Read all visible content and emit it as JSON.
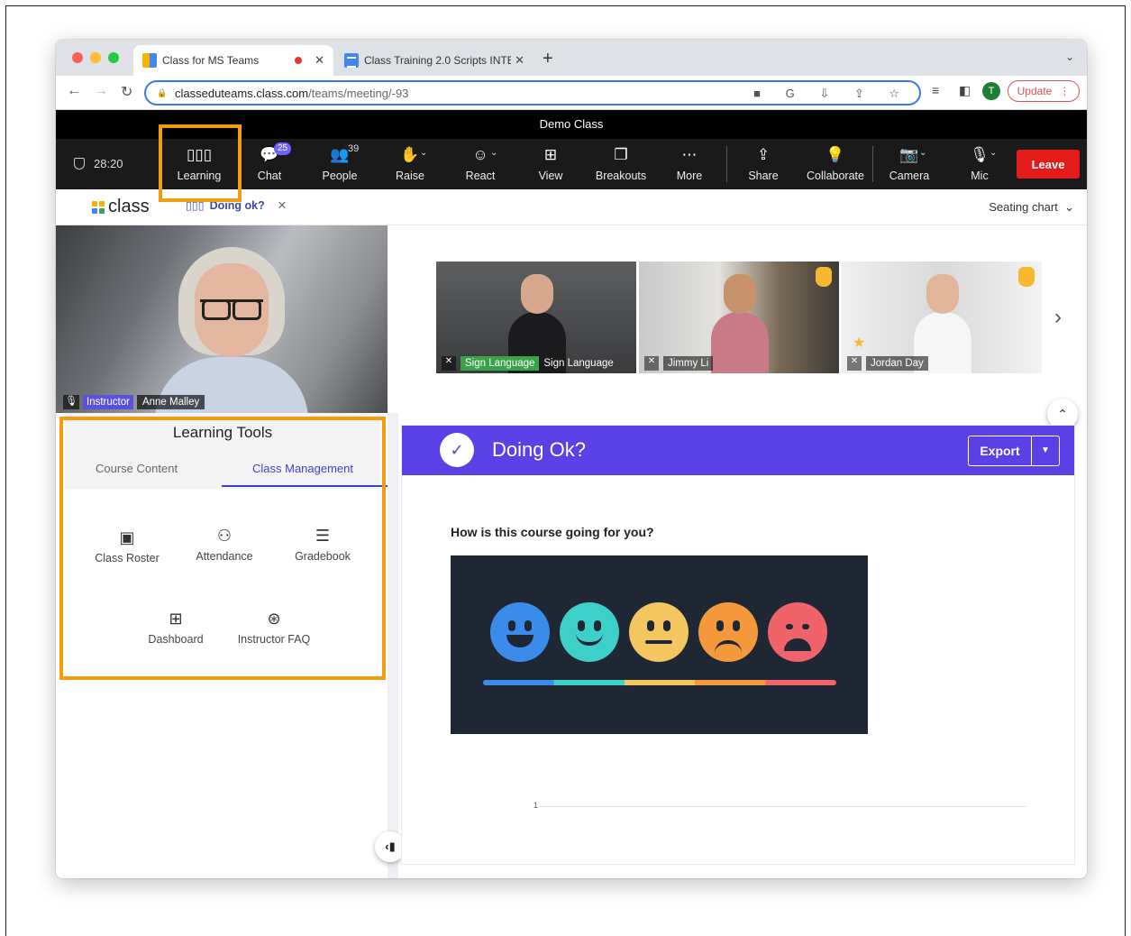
{
  "browser": {
    "tabs": [
      {
        "title": "Class for MS Teams",
        "active": true
      },
      {
        "title": "Class Training 2.0 Scripts INTE",
        "active": false
      }
    ],
    "url_host": "classeduteams.class.com",
    "url_path": "/teams/meeting/-93",
    "profile_initial": "T",
    "update_label": "Update"
  },
  "meeting": {
    "title": "Demo Class",
    "timer": "28:20"
  },
  "toolbar": {
    "learning": "Learning",
    "chat": "Chat",
    "chat_badge": "25",
    "people": "People",
    "people_count": "39",
    "raise": "Raise",
    "react": "React",
    "view": "View",
    "breakouts": "Breakouts",
    "more": "More",
    "share": "Share",
    "collaborate": "Collaborate",
    "camera": "Camera",
    "mic": "Mic",
    "leave": "Leave"
  },
  "app": {
    "logo_text": "class",
    "open_tab": "Doing ok?",
    "seating_chart": "Seating chart"
  },
  "main_video": {
    "role": "Instructor",
    "name": "Anne Malley"
  },
  "participants": [
    {
      "tag": "Sign Language",
      "name": "Sign Language"
    },
    {
      "name": "Jimmy Li"
    },
    {
      "name": "Jordan Day"
    }
  ],
  "learning_tools": {
    "title": "Learning Tools",
    "tabs": [
      "Course Content",
      "Class Management"
    ],
    "active_tab": "Class Management",
    "items": [
      {
        "label": "Class Roster",
        "icon": "roster-icon"
      },
      {
        "label": "Attendance",
        "icon": "attendance-icon"
      },
      {
        "label": "Gradebook",
        "icon": "gradebook-icon"
      },
      {
        "label": "Dashboard",
        "icon": "dashboard-icon"
      },
      {
        "label": "Instructor FAQ",
        "icon": "help-icon"
      }
    ]
  },
  "poll": {
    "title": "Doing Ok?",
    "export": "Export",
    "question": "How is this course going for you?",
    "axis_tick": "1"
  },
  "colors": {
    "accent": "#5a41e6",
    "leave": "#e21b1b",
    "highlight": "#f39c12",
    "toolbar": "#1a1a1a"
  }
}
